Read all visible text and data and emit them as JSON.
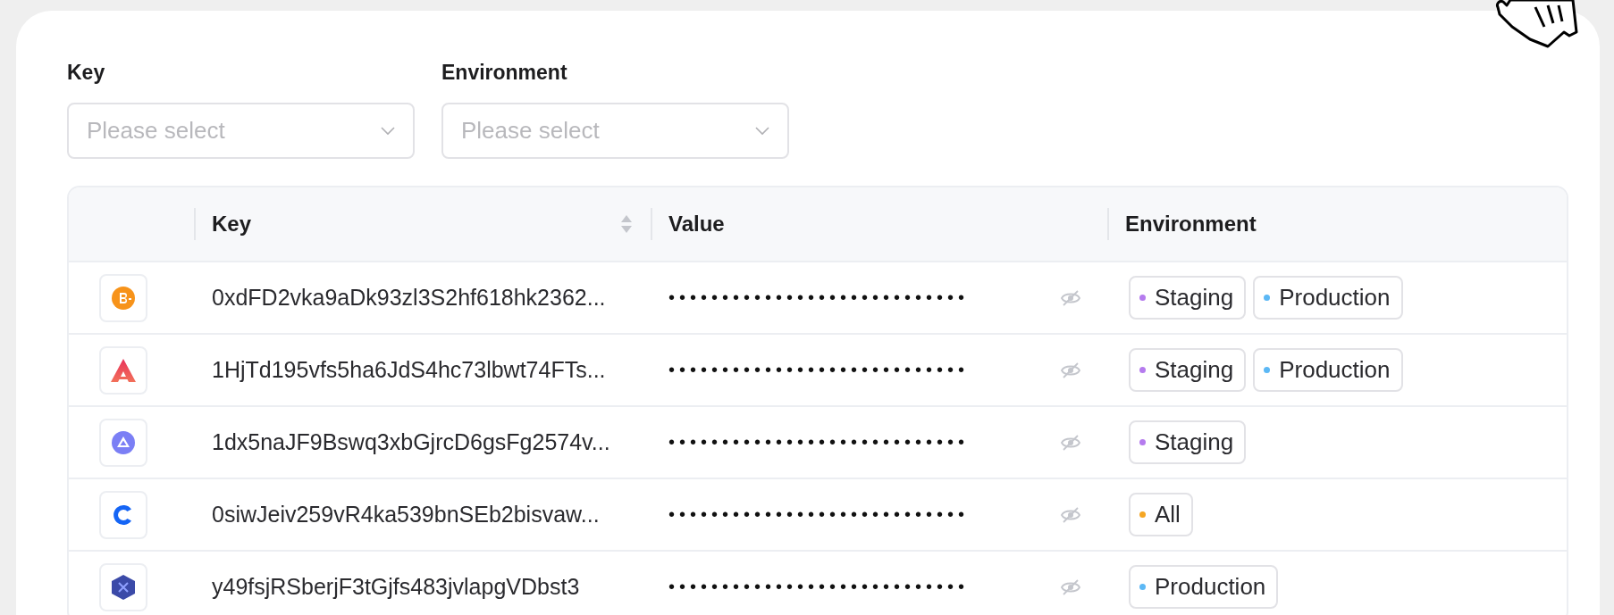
{
  "filters": [
    {
      "label": "Key",
      "placeholder": "Please select"
    },
    {
      "label": "Environment",
      "placeholder": "Please select"
    }
  ],
  "table": {
    "columns": [
      "Key",
      "Value",
      "Environment"
    ],
    "rows": [
      {
        "key": "0xdFD2vka9aDk93zl3S2hf618hk2362...",
        "value": "••••••••••••••••••••••••••••",
        "environments": [
          {
            "label": "Staging",
            "color": "#b57bee"
          },
          {
            "label": "Production",
            "color": "#5cb8f5"
          }
        ]
      },
      {
        "key": "1HjTd195vfs5ha6JdS4hc73lbwt74FTs...",
        "value": "••••••••••••••••••••••••••••",
        "environments": [
          {
            "label": "Staging",
            "color": "#b57bee"
          },
          {
            "label": "Production",
            "color": "#5cb8f5"
          }
        ]
      },
      {
        "key": "1dx5naJF9Bswq3xbGjrcD6gsFg2574v...",
        "value": "••••••••••••••••••••••••••••",
        "environments": [
          {
            "label": "Staging",
            "color": "#b57bee"
          }
        ]
      },
      {
        "key": "0siwJeiv259vR4ka539bnSEb2bisvaw...",
        "value": "••••••••••••••••••••••••••••",
        "environments": [
          {
            "label": "All",
            "color": "#f5a623"
          }
        ]
      },
      {
        "key": "y49fsjRSberjF3tGjfs483jvlapgVDbst3",
        "value": "••••••••••••••••••••••••••••",
        "environments": [
          {
            "label": "Production",
            "color": "#5cb8f5"
          }
        ]
      }
    ]
  }
}
